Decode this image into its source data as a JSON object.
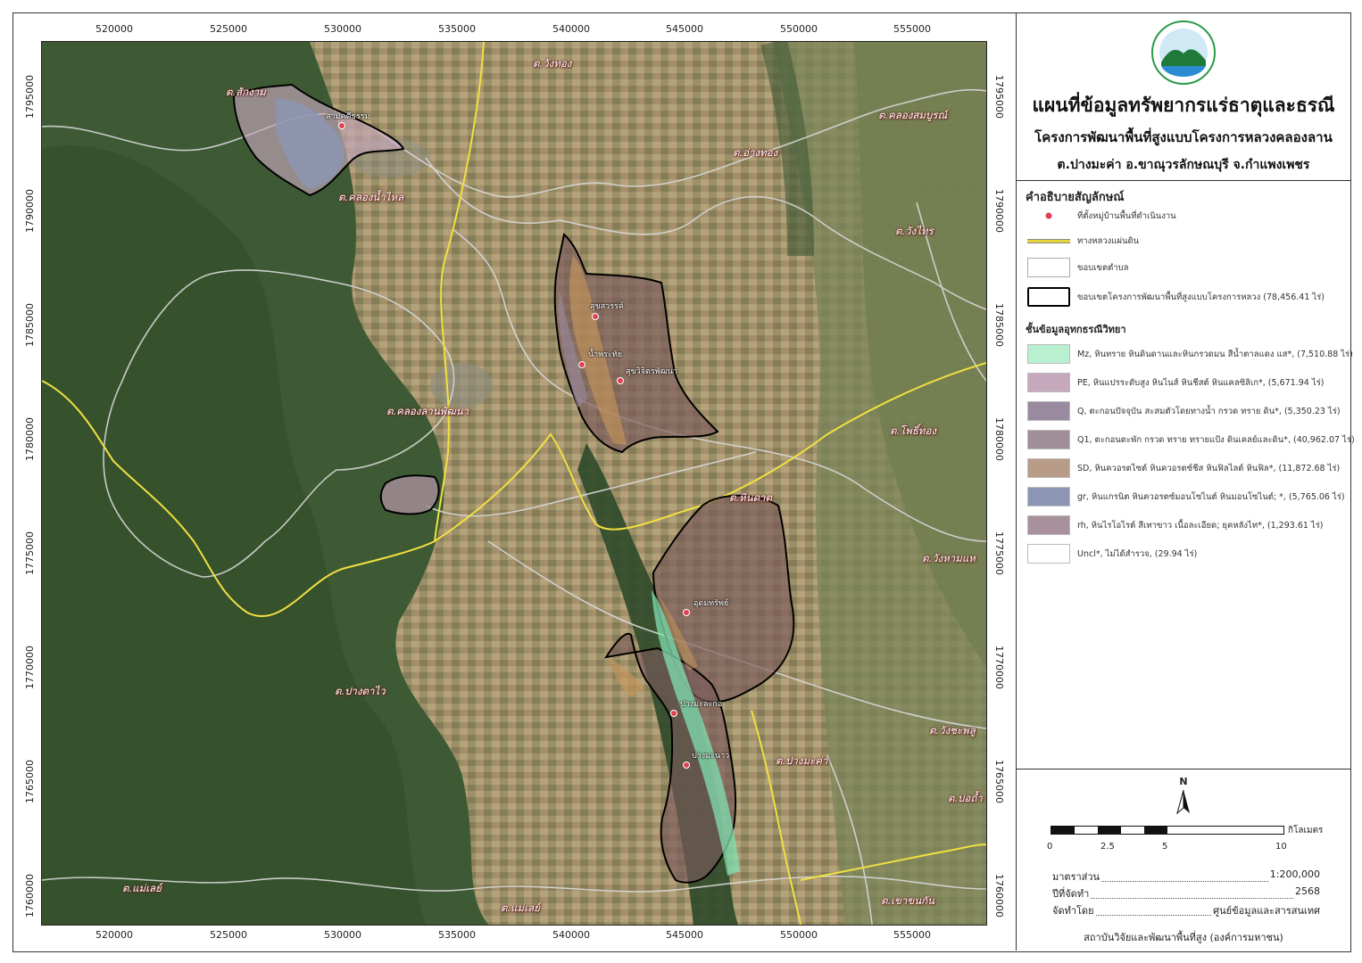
{
  "map": {
    "x_ticks": [
      "520000",
      "525000",
      "530000",
      "535000",
      "540000",
      "545000",
      "550000",
      "555000"
    ],
    "y_ticks": [
      "1795000",
      "1790000",
      "1785000",
      "1780000",
      "1775000",
      "1770000",
      "1765000",
      "1760000"
    ],
    "subdistrict_labels": [
      "ต.สักงาม",
      "ต.วังทอง",
      "ต.คลองสมบูรณ์",
      "ต.อ่างทอง",
      "ต.คลองน้ำไหล",
      "ต.วังไทร",
      "ต.คลองลานพัฒนา",
      "ต.โพธิ์ทอง",
      "ต.หินดาต",
      "ต.วังหามแห",
      "ต.ปางตาไว",
      "ต.วังชะพลู",
      "ต.ปางมะค่า",
      "ต.บ่อถ้ำ",
      "ต.แม่เลย์",
      "ต.แม่เลย์",
      "ต.เขาขนกัน"
    ],
    "village_labels": [
      "สามัคคีธรรม",
      "สุขสวรรค์",
      "น้ำพระทัย",
      "สุขวิจิตรพัฒนา",
      "อุดมทรัพย์",
      "ปางมะละกอ",
      "ปางมะนาว"
    ],
    "colors": {
      "project_boundary": "#000000",
      "highway": "#f0e040",
      "subdistrict": "#d8d8d8",
      "village_marker": "#e04050"
    }
  },
  "panel": {
    "logo_icon": "mountain-logo-icon",
    "title": "แผนที่ข้อมูลทรัพยากรแร่ธาตุและธรณี",
    "subtitle": "โครงการพัฒนาพื้นที่สูงแบบโครงการหลวงคลองลาน",
    "location": "ต.ปางมะค่า อ.ขาณุวรลักษณบุรี จ.กำแพงเพชร",
    "legend_heading": "คำอธิบายสัญลักษณ์",
    "legend_items": [
      {
        "label": "ที่ตั้งหมู่บ้านพื้นที่ดำเนินงาน",
        "symbol": "village-marker-icon"
      },
      {
        "label": "ทางหลวงแผ่นดิน",
        "symbol": "highway-line-icon"
      },
      {
        "label": "ขอบเขตตำบล",
        "symbol": "subdistrict-boundary-icon"
      },
      {
        "label": "ขอบเขตโครงการพัฒนาพื้นที่สูงแบบโครงการหลวง (78,456.41 ไร่)",
        "symbol": "project-boundary-icon"
      }
    ],
    "geo_heading": "ชั้นข้อมูลอุทกธรณีวิทยา",
    "geo_items": [
      {
        "label": "Mz,  หินทราย หินดินดานและหินกรวดมน สีน้ำตาลแดง แส*, (7,510.88 ไร่)",
        "color": "#b8f0d0"
      },
      {
        "label": "PE,  หินแปรระดับสูง หินไนส์ หินชีสต์ หินแคลซิลิเก*, (5,671.94 ไร่)",
        "color": "#c6a8bc"
      },
      {
        "label": "Q,  ตะกอนปัจจุบัน สะสมตัวโดยทางน้ำ กรวด  ทราย ดิน*, (5,350.23 ไร่)",
        "color": "#9a8aa0"
      },
      {
        "label": "Q1,  ตะกอนตะพัก กรวด ทราย ทรายแป้ง ดินเคลย์และดิน*, (40,962.07 ไร่)",
        "color": "#a08e98"
      },
      {
        "label": "SD,  หินควอรตไซต์ หินควอรตซ์ชีส หินฟิลไลต์ หินฟิล*, (11,872.68 ไร่)",
        "color": "#b89c88"
      },
      {
        "label": "gr,  หินแกรนิต หินควอรตซ์มอนโซไนต์ หินมอนโซไนต์; *, (5,765.06 ไร่)",
        "color": "#8c96b4"
      },
      {
        "label": "rh,  หินไรโอไรต์ สีเทาขาว เนื้อละเอียด; ยุคหลังไท*, (1,293.61 ไร่)",
        "color": "#a8909c"
      },
      {
        "label": "Uncl*, ไม่ได้สำรวจ, (29.94 ไร่)",
        "color": "#ffffff"
      }
    ],
    "north_label": "N",
    "scale_ticks": [
      "0",
      "2.5",
      "5",
      "10"
    ],
    "scale_unit": "กิโลเมตร",
    "scale_label": "มาตราส่วน",
    "scale_value": "1:200,000",
    "year_label": "ปีที่จัดทำ",
    "year_value": "2568",
    "author_label": "จัดทำโดย",
    "author_value": "ศูนย์ข้อมูลและสารสนเทศ",
    "institute": "สถาบันวิจัยและพัฒนาพื้นที่สูง (องค์การมหาชน)"
  }
}
